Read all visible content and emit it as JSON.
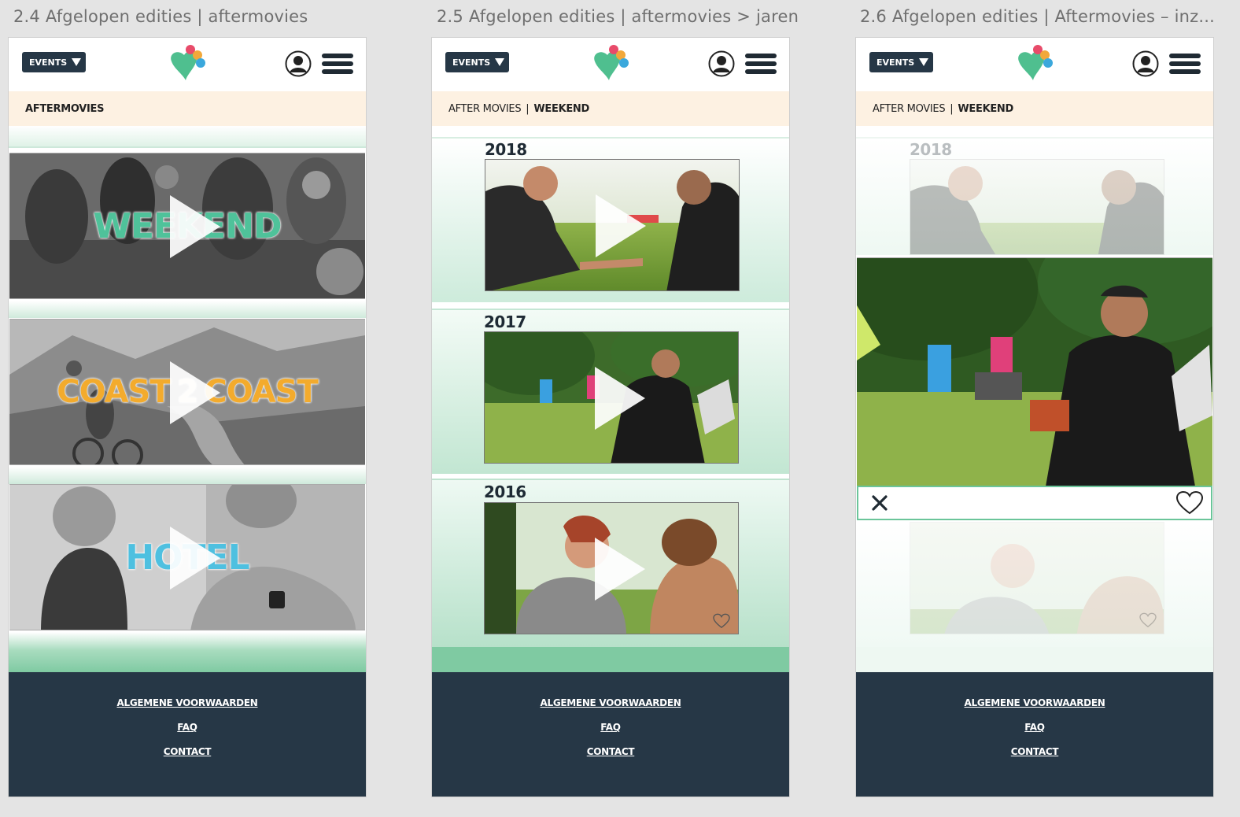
{
  "frames": [
    {
      "label": "2.4 Afgelopen edities | aftermovies",
      "header": {
        "events_label": "EVENTS"
      },
      "breadcrumb": {
        "prefix": "",
        "current": "AFTERMOVIES"
      },
      "tiles": [
        {
          "title": "WEEKEND"
        },
        {
          "title_a": "COAST",
          "title_num": "2",
          "title_b": "COAST"
        },
        {
          "title": "HOTEL"
        }
      ],
      "footer": {
        "links": [
          "ALGEMENE VOORWAARDEN",
          "FAQ",
          "CONTACT"
        ]
      }
    },
    {
      "label": "2.5 Afgelopen edities | aftermovies > jaren",
      "header": {
        "events_label": "EVENTS"
      },
      "breadcrumb": {
        "prefix": "AFTER MOVIES",
        "separator": "|",
        "current": "WEEKEND"
      },
      "years": [
        "2018",
        "2017",
        "2016"
      ],
      "footer": {
        "links": [
          "ALGEMENE VOORWAARDEN",
          "FAQ",
          "CONTACT"
        ]
      }
    },
    {
      "label": "2.6 Afgelopen edities | Aftermovies – inz...",
      "header": {
        "events_label": "EVENTS"
      },
      "breadcrumb": {
        "prefix": "AFTER MOVIES",
        "separator": "|",
        "current": "WEEKEND"
      },
      "years": [
        "2018"
      ],
      "footer": {
        "links": [
          "ALGEMENE VOORWAARDEN",
          "FAQ",
          "CONTACT"
        ]
      }
    }
  ],
  "icons": {
    "logo": "heart-balloon-logo",
    "user": "user-icon",
    "menu": "hamburger-menu-icon",
    "dropdown": "triangle-down-icon",
    "play": "play-icon",
    "close": "close-icon",
    "favorite": "heart-icon"
  },
  "colors": {
    "navy": "#263746",
    "mint": "#7fcaa2",
    "crumb_bg": "#fdf1e2",
    "weekend_title": "#4fc29a",
    "coast_title": "#f3ab2d",
    "hotel_title": "#4ec0e0"
  }
}
